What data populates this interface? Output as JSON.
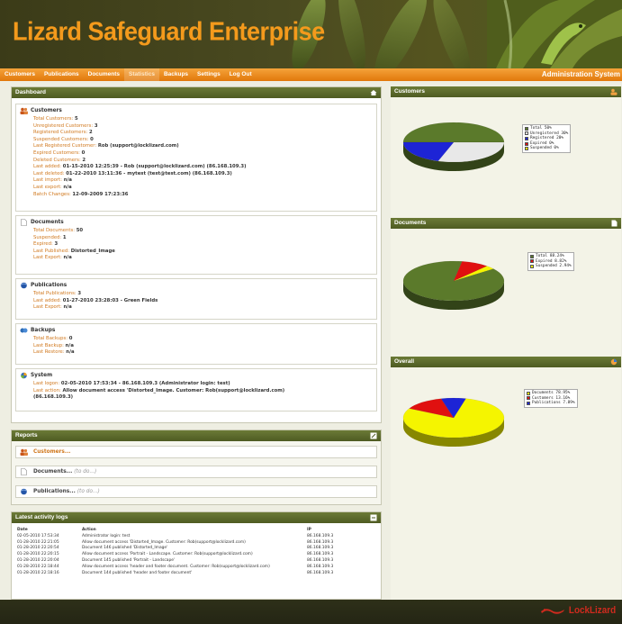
{
  "app": {
    "title": "Lizard Safeguard Enterprise",
    "header_right": "Administration System"
  },
  "nav": [
    "Customers",
    "Publications",
    "Documents",
    "Statistics",
    "Backups",
    "Settings",
    "Log Out"
  ],
  "nav_active": "Statistics",
  "dashboard": {
    "title": "Dashboard",
    "customers": {
      "title": "Customers",
      "rows": [
        {
          "label": "Total Customers:",
          "value": "5"
        },
        {
          "label": "Unregistered Customers:",
          "value": "3"
        },
        {
          "label": "Registered Customers:",
          "value": "2"
        },
        {
          "label": "Suspended Customers:",
          "value": "0"
        },
        {
          "label": "Last Registered Customer:",
          "value": "Rob (support@locklizard.com)"
        },
        {
          "label": "Expired Customers:",
          "value": "0"
        },
        {
          "label": "Deleted Customers:",
          "value": "2"
        },
        {
          "label": "Last added:",
          "value": "01-15-2010 12:25:39 - Rob (support@locklizard.com) (86.168.109.3)"
        },
        {
          "label": "Last deleted:",
          "value": "01-22-2010 13:11:36 - mytest (test@test.com) (86.168.109.3)"
        },
        {
          "label": "Last import:",
          "value": "n/a"
        },
        {
          "label": "Last export:",
          "value": "n/a"
        },
        {
          "label": "Batch Changes:",
          "value": "12-09-2009 17:23:36"
        }
      ]
    },
    "documents": {
      "title": "Documents",
      "rows": [
        {
          "label": "Total Documents:",
          "value": "50"
        },
        {
          "label": "Suspended:",
          "value": "1"
        },
        {
          "label": "Expired:",
          "value": "3"
        },
        {
          "label": "Last Published:",
          "value": "Distorted_Image"
        },
        {
          "label": "Last Export:",
          "value": "n/a"
        }
      ]
    },
    "publications": {
      "title": "Publications",
      "rows": [
        {
          "label": "Total Publications:",
          "value": "3"
        },
        {
          "label": "Last added:",
          "value": "01-27-2010 23:28:03 - Green Fields"
        },
        {
          "label": "Last Export:",
          "value": "n/a"
        }
      ]
    },
    "backups": {
      "title": "Backups",
      "rows": [
        {
          "label": "Total Backups:",
          "value": "0"
        },
        {
          "label": "Last Backup:",
          "value": "n/a"
        },
        {
          "label": "Last Restore:",
          "value": "n/a"
        }
      ]
    },
    "system": {
      "title": "System",
      "rows": [
        {
          "label": "Last logon:",
          "value": "02-05-2010 17:53:34 - 86.168.109.3 (Administrator login: test)"
        },
        {
          "label": "Last action:",
          "value": "Allow document access 'Distorted_Image. Customer: Rob(support@locklizard.com)"
        },
        {
          "label": "",
          "value": "(86.168.109.3)"
        }
      ]
    }
  },
  "reports": {
    "title": "Reports",
    "items": [
      {
        "label": "Customers...",
        "todo": ""
      },
      {
        "label": "Documents...",
        "todo": "(to do...)"
      },
      {
        "label": "Publications...",
        "todo": "(to do...)"
      }
    ]
  },
  "activity": {
    "title": "Latest activity logs",
    "headers": [
      "Date",
      "Action",
      "IP"
    ],
    "rows": [
      [
        "02-05-2010 17:53:34",
        "Administrator login: test",
        "86.168.109.3"
      ],
      [
        "01-28-2010 22:21:05",
        "Allow document access 'Distorted_Image. Customer: Rob(support@locklizard.com)",
        "86.168.109.3"
      ],
      [
        "01-28-2010 22:20:54",
        "Document 146 published 'Distorted_Image'",
        "86.168.109.3"
      ],
      [
        "01-28-2010 22:20:15",
        "Allow document access 'Portrait - Landscape. Customer: Rob(support@locklizard.com)",
        "86.168.109.3"
      ],
      [
        "01-28-2010 22:20:04",
        "Document 145 published 'Portrait - Landscape'",
        "86.168.109.3"
      ],
      [
        "01-28-2010 22:18:44",
        "Allow document access 'header and footer document. Customer: Rob(support@locklizard.com)",
        "86.168.109.3"
      ],
      [
        "01-28-2010 22:18:16",
        "Document 144 published 'header and footer document'",
        "86.168.109.3"
      ]
    ]
  },
  "charts": {
    "customers_title": "Customers",
    "documents_title": "Documents",
    "overall_title": "Overall"
  },
  "chart_data": [
    {
      "type": "pie",
      "title": "Customers",
      "legend": [
        "Total 50%",
        "Unregistered 30%",
        "Registered 20%",
        "Expired 0%",
        "Suspended 0%"
      ],
      "categories": [
        "Total",
        "Unregistered",
        "Registered",
        "Expired",
        "Suspended"
      ],
      "values": [
        50,
        30,
        20,
        0,
        0
      ],
      "colors": [
        "#5b7a2b",
        "#e8e8e8",
        "#1d24d6",
        "#e01010",
        "#f5f500"
      ]
    },
    {
      "type": "pie",
      "title": "Documents",
      "legend": [
        "Total 88.24%",
        "Expired 8.82%",
        "Suspended 2.94%"
      ],
      "categories": [
        "Total",
        "Expired",
        "Suspended"
      ],
      "values": [
        88.24,
        8.82,
        2.94
      ],
      "colors": [
        "#5b7a2b",
        "#e01010",
        "#f5f500"
      ]
    },
    {
      "type": "pie",
      "title": "Overall",
      "legend": [
        "Documents 78.95%",
        "Customers 13.16%",
        "Publications 7.89%"
      ],
      "categories": [
        "Documents",
        "Customers",
        "Publications"
      ],
      "values": [
        78.95,
        13.16,
        7.89
      ],
      "colors": [
        "#f5f500",
        "#e01010",
        "#1d24d6"
      ]
    }
  ],
  "footer": {
    "logo": "LockLizard",
    "copyright": ""
  }
}
